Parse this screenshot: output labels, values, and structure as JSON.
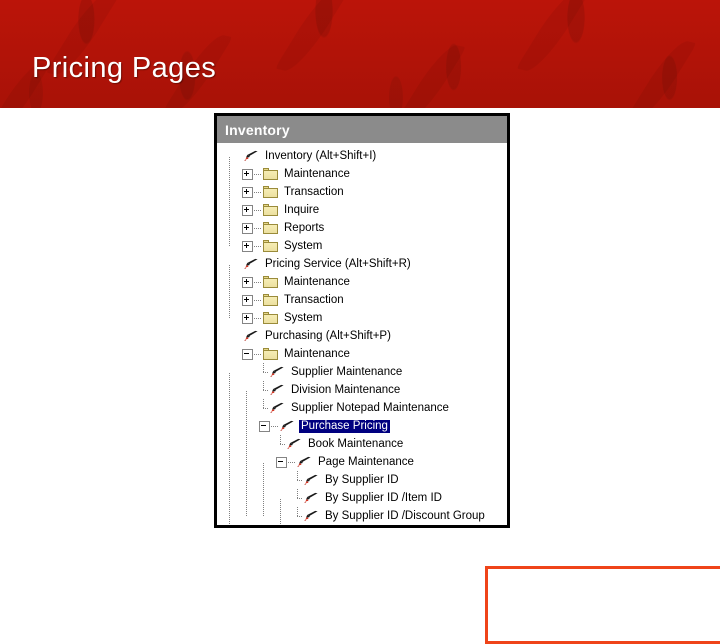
{
  "slide": {
    "title": "Pricing Pages",
    "banner_color": "#b01408",
    "title_color": "#ffffff"
  },
  "panel": {
    "header_title": "Inventory",
    "header_bg": "#8b8b8b",
    "border_color": "#000000",
    "selection_color": "#000080",
    "callout_color": "#ef4419"
  },
  "tree": {
    "items": [
      {
        "label": "Inventory (Alt+Shift+I)",
        "depth": 0,
        "icon": "shortcut-icon",
        "expander": "none",
        "selected": false
      },
      {
        "label": "Maintenance",
        "depth": 1,
        "icon": "folder-icon",
        "expander": "plus",
        "selected": false
      },
      {
        "label": "Transaction",
        "depth": 1,
        "icon": "folder-icon",
        "expander": "plus",
        "selected": false
      },
      {
        "label": "Inquire",
        "depth": 1,
        "icon": "folder-icon",
        "expander": "plus",
        "selected": false
      },
      {
        "label": "Reports",
        "depth": 1,
        "icon": "folder-icon",
        "expander": "plus",
        "selected": false
      },
      {
        "label": "System",
        "depth": 1,
        "icon": "folder-icon",
        "expander": "plus",
        "selected": false
      },
      {
        "label": "Pricing Service (Alt+Shift+R)",
        "depth": 0,
        "icon": "shortcut-icon",
        "expander": "none",
        "selected": false
      },
      {
        "label": "Maintenance",
        "depth": 1,
        "icon": "folder-icon",
        "expander": "plus",
        "selected": false
      },
      {
        "label": "Transaction",
        "depth": 1,
        "icon": "folder-icon",
        "expander": "plus",
        "selected": false
      },
      {
        "label": "System",
        "depth": 1,
        "icon": "folder-icon",
        "expander": "plus",
        "selected": false
      },
      {
        "label": "Purchasing (Alt+Shift+P)",
        "depth": 0,
        "icon": "shortcut-icon",
        "expander": "none",
        "selected": false
      },
      {
        "label": "Maintenance",
        "depth": 1,
        "icon": "folder-icon",
        "expander": "minus",
        "selected": false
      },
      {
        "label": "Supplier Maintenance",
        "depth": 2,
        "icon": "shortcut-icon",
        "expander": "none",
        "selected": false
      },
      {
        "label": "Division Maintenance",
        "depth": 2,
        "icon": "shortcut-icon",
        "expander": "none",
        "selected": false
      },
      {
        "label": "Supplier Notepad Maintenance",
        "depth": 2,
        "icon": "shortcut-icon",
        "expander": "none",
        "selected": false
      },
      {
        "label": "Purchase Pricing",
        "depth": 2,
        "icon": "shortcut-icon",
        "expander": "minus",
        "selected": true
      },
      {
        "label": "Book Maintenance",
        "depth": 3,
        "icon": "shortcut-icon",
        "expander": "none",
        "selected": false
      },
      {
        "label": "Page Maintenance",
        "depth": 3,
        "icon": "shortcut-icon",
        "expander": "minus",
        "selected": false
      },
      {
        "label": "By Supplier ID",
        "depth": 4,
        "icon": "shortcut-icon",
        "expander": "none",
        "selected": false
      },
      {
        "label": "By Supplier ID /Item ID",
        "depth": 4,
        "icon": "shortcut-icon",
        "expander": "none",
        "selected": false
      },
      {
        "label": "By Supplier ID /Discount Group",
        "depth": 4,
        "icon": "shortcut-icon",
        "expander": "none",
        "selected": false
      }
    ]
  }
}
